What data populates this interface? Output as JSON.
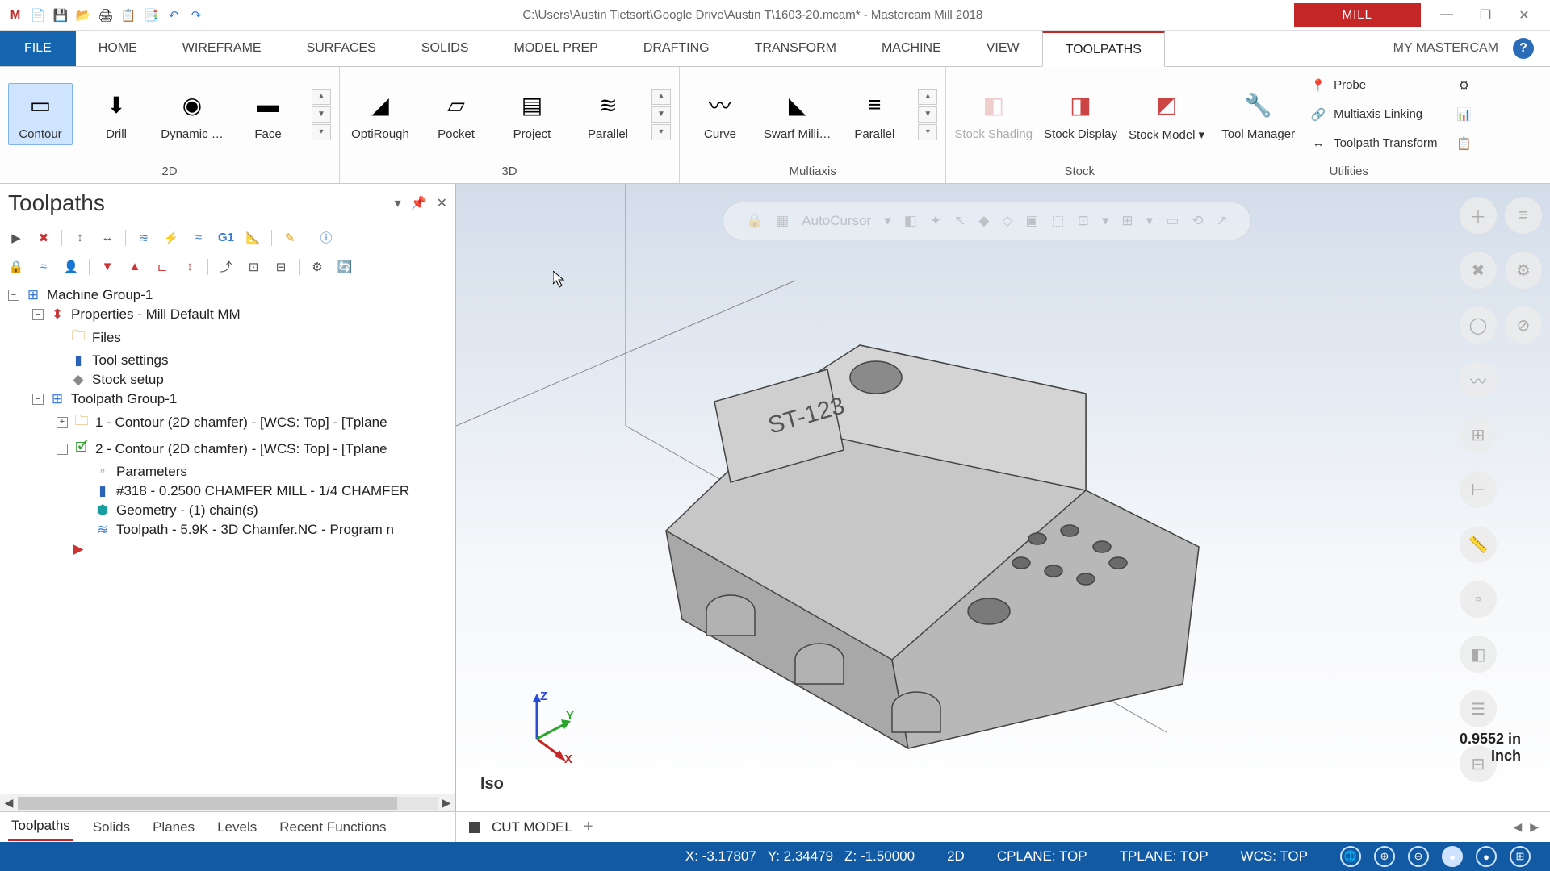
{
  "app": {
    "title": "C:\\Users\\Austin Tietsort\\Google Drive\\Austin T\\1603-20.mcam* - Mastercam Mill 2018",
    "context_tab": "MILL",
    "mymc": "MY MASTERCAM"
  },
  "tabs": {
    "file": "FILE",
    "items": [
      "HOME",
      "WIREFRAME",
      "SURFACES",
      "SOLIDS",
      "MODEL PREP",
      "DRAFTING",
      "TRANSFORM",
      "MACHINE",
      "VIEW",
      "TOOLPATHS"
    ],
    "active": "TOOLPATHS"
  },
  "ribbon": {
    "g2d": {
      "label": "2D",
      "contour": "Contour",
      "drill": "Drill",
      "dynamic": "Dynamic …",
      "face": "Face"
    },
    "g3d": {
      "label": "3D",
      "optirough": "OptiRough",
      "pocket": "Pocket",
      "project": "Project",
      "parallel": "Parallel"
    },
    "multi": {
      "label": "Multiaxis",
      "curve": "Curve",
      "swarf": "Swarf Milli…",
      "parallel": "Parallel"
    },
    "stock": {
      "label": "Stock",
      "shading": "Stock Shading",
      "display": "Stock Display",
      "model": "Stock Model ▾"
    },
    "util": {
      "label": "Utilities",
      "tm": "Tool Manager",
      "probe": "Probe",
      "ml": "Multiaxis Linking",
      "tt": "Toolpath Transform"
    }
  },
  "panel": {
    "title": "Toolpaths",
    "tree": {
      "mg": "Machine Group-1",
      "prop": "Properties - Mill Default MM",
      "files": "Files",
      "ts": "Tool settings",
      "ss": "Stock setup",
      "tg": "Toolpath Group-1",
      "op1": "1 - Contour (2D chamfer) - [WCS: Top] - [Tplane",
      "op2": "2 - Contour (2D chamfer) - [WCS: Top] - [Tplane",
      "param": "Parameters",
      "tool": "#318 - 0.2500 CHAMFER MILL - 1/4 CHAMFER",
      "geom": "Geometry -  (1) chain(s)",
      "tp": "Toolpath - 5.9K - 3D Chamfer.NC - Program n"
    }
  },
  "viewport": {
    "autocursor": "AutoCursor",
    "part_text": "ST-123",
    "iso": "Iso",
    "scale_val": "0.9552 in",
    "scale_unit": "Inch"
  },
  "bottom_tabs": {
    "panel": [
      "Toolpaths",
      "Solids",
      "Planes",
      "Levels",
      "Recent Functions"
    ],
    "doc": "CUT MODEL"
  },
  "status": {
    "x": "X:   -3.17807",
    "y": "Y:   2.34479",
    "z": "Z:   -1.50000",
    "mode": "2D",
    "cplane": "CPLANE: TOP",
    "tplane": "TPLANE: TOP",
    "wcs": "WCS: TOP"
  }
}
